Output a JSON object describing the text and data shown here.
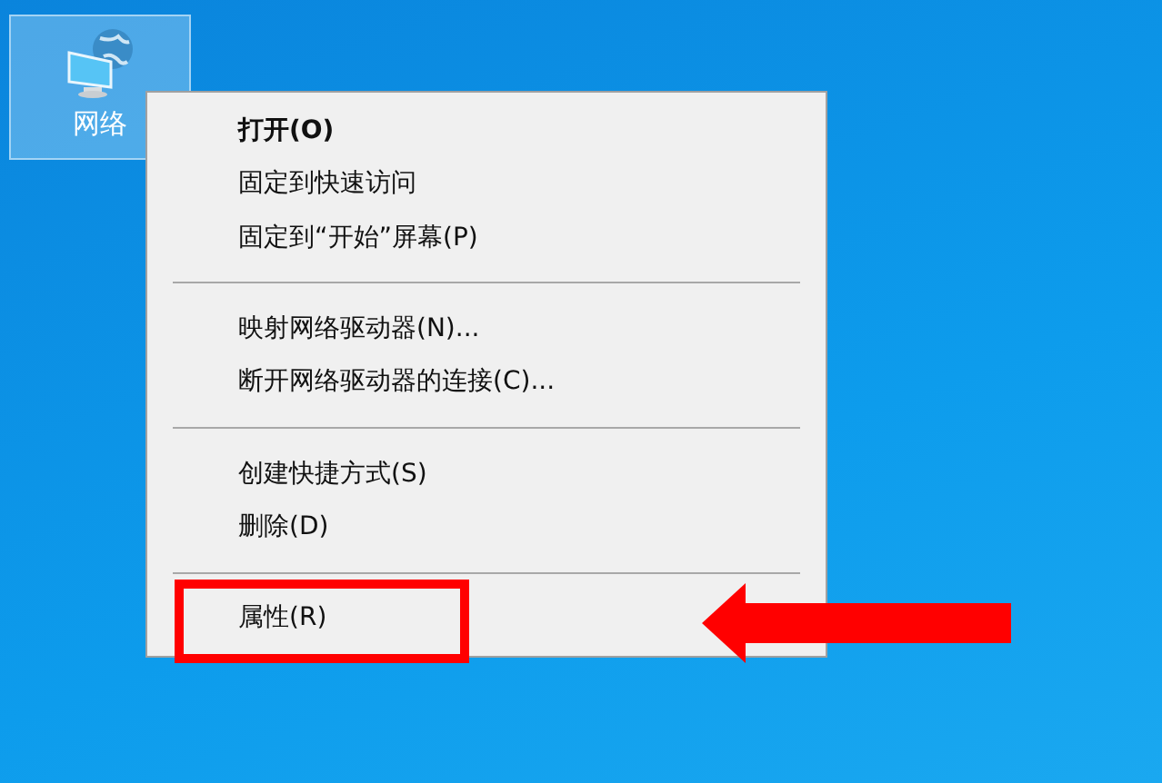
{
  "desktop_icon": {
    "label": "网络",
    "selected": true
  },
  "context_menu": {
    "groups": [
      [
        {
          "label": "打开(O)",
          "default": true,
          "highlighted": false
        },
        {
          "label": "固定到快速访问",
          "default": false,
          "highlighted": false
        },
        {
          "label": "固定到“开始”屏幕(P)",
          "default": false,
          "highlighted": false
        }
      ],
      [
        {
          "label": "映射网络驱动器(N)...",
          "default": false,
          "highlighted": false
        },
        {
          "label": "断开网络驱动器的连接(C)...",
          "default": false,
          "highlighted": false
        }
      ],
      [
        {
          "label": "创建快捷方式(S)",
          "default": false,
          "highlighted": false
        },
        {
          "label": "删除(D)",
          "default": false,
          "highlighted": false
        }
      ],
      [
        {
          "label": "属性(R)",
          "default": false,
          "highlighted": true
        }
      ]
    ]
  }
}
